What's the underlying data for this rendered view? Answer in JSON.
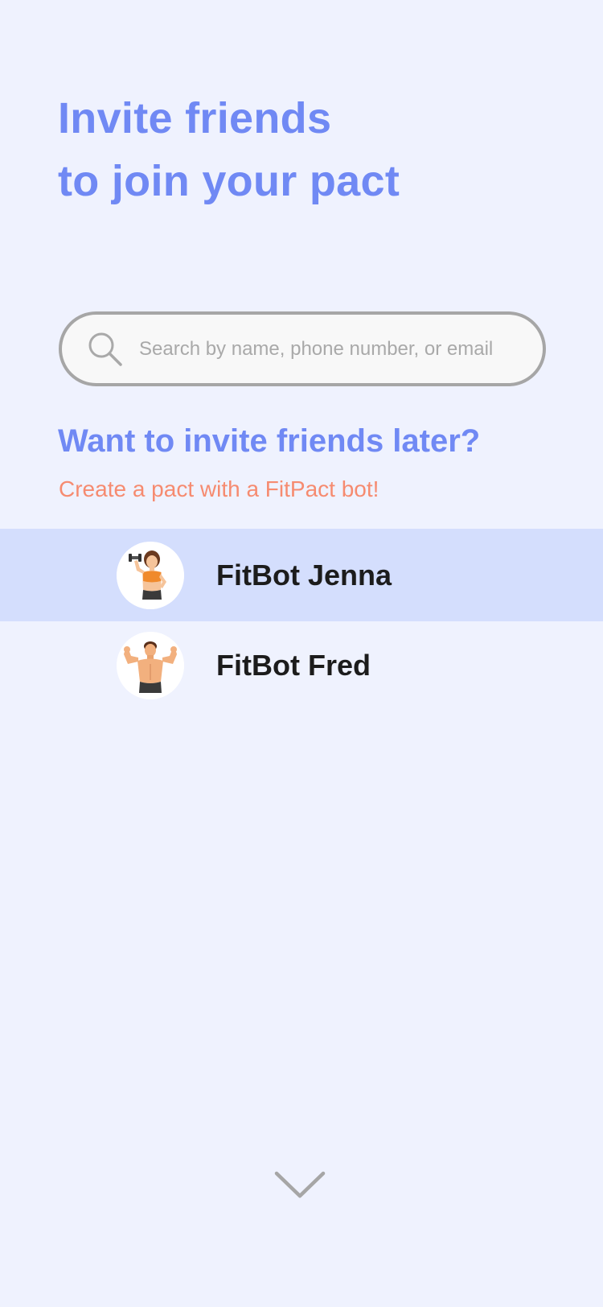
{
  "header": {
    "title_line1": "Invite friends",
    "title_line2": "to join your pact"
  },
  "search": {
    "placeholder": "Search by name, phone number, or email",
    "value": "",
    "icon": "search-icon"
  },
  "later": {
    "title": "Want to invite friends later?",
    "subtitle": "Create a pact with a FitPact bot!"
  },
  "bots": [
    {
      "name": "FitBot Jenna",
      "avatar": "female-fitness-avatar",
      "selected": true
    },
    {
      "name": "FitBot Fred",
      "avatar": "male-bodybuilder-avatar",
      "selected": false
    }
  ],
  "footer": {
    "icon": "chevron-down-icon"
  },
  "colors": {
    "background": "#eff2fe",
    "accent_blue": "#7089f4",
    "accent_orange": "#f68b70",
    "selected_row": "#d4defd",
    "text_dark": "#1c1c1c",
    "border_gray": "#a6a6a6"
  }
}
